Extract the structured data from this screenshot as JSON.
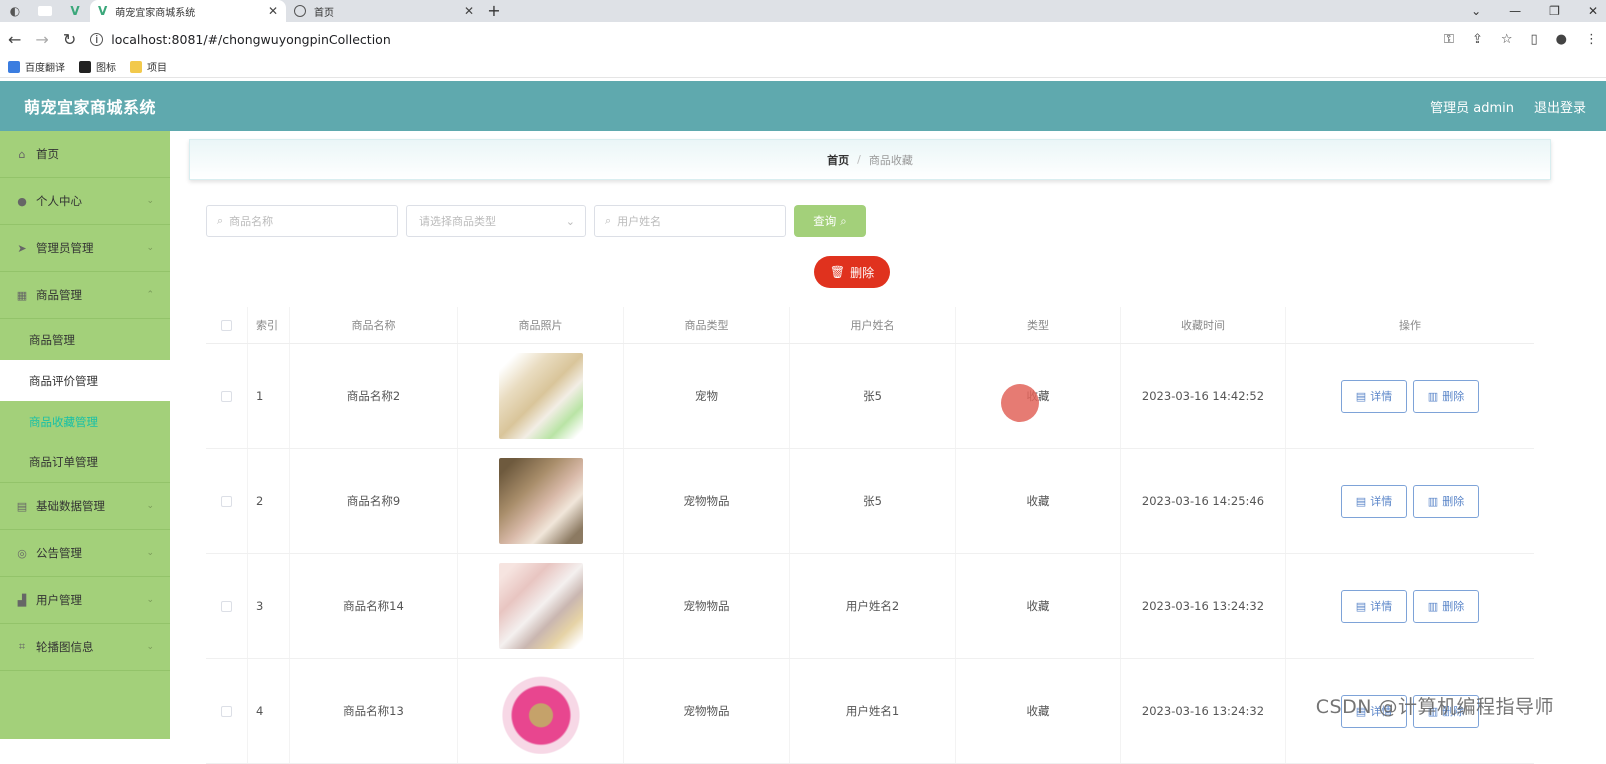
{
  "browser": {
    "tabs": [
      {
        "title": "萌宠宜家商城系统",
        "active": true
      },
      {
        "title": "首页",
        "active": false
      }
    ],
    "url": "localhost:8081/#/chongwuyongpinCollection",
    "bookmarks": [
      "百度翻译",
      "图标",
      "项目"
    ]
  },
  "header": {
    "title": "萌宠宜家商城系统",
    "user": "管理员 admin",
    "logout": "退出登录"
  },
  "sidebar": {
    "items": [
      {
        "label": "首页",
        "icon": "home-icon"
      },
      {
        "label": "个人中心",
        "icon": "user-icon"
      },
      {
        "label": "管理员管理",
        "icon": "send-icon"
      },
      {
        "label": "商品管理",
        "icon": "grid-icon"
      },
      {
        "label": "基础数据管理",
        "icon": "data-icon"
      },
      {
        "label": "公告管理",
        "icon": "notice-icon"
      },
      {
        "label": "用户管理",
        "icon": "users-icon"
      },
      {
        "label": "轮播图信息",
        "icon": "crop-icon"
      }
    ],
    "submenu": [
      "商品管理",
      "商品评价管理",
      "商品收藏管理",
      "商品订单管理"
    ]
  },
  "breadcrumb": {
    "home": "首页",
    "separator": "/",
    "current": "商品收藏"
  },
  "search": {
    "name_placeholder": "商品名称",
    "type_placeholder": "请选择商品类型",
    "user_placeholder": "用户姓名",
    "button": "查询"
  },
  "delete_button": "删除",
  "table": {
    "headers": [
      "索引",
      "商品名称",
      "商品照片",
      "商品类型",
      "用户姓名",
      "类型",
      "收藏时间",
      "操作"
    ],
    "rows": [
      {
        "index": "1",
        "name": "商品名称2",
        "category": "宠物",
        "user": "张5",
        "type": "收藏",
        "time": "2023-03-16 14:42:52"
      },
      {
        "index": "2",
        "name": "商品名称9",
        "category": "宠物物品",
        "user": "张5",
        "type": "收藏",
        "time": "2023-03-16 14:25:46"
      },
      {
        "index": "3",
        "name": "商品名称14",
        "category": "宠物物品",
        "user": "用户姓名2",
        "type": "收藏",
        "time": "2023-03-16 13:24:32"
      },
      {
        "index": "4",
        "name": "商品名称13",
        "category": "宠物物品",
        "user": "用户姓名1",
        "type": "收藏",
        "time": "2023-03-16 13:24:32"
      }
    ],
    "detail_label": "详情",
    "delete_label": "删除"
  },
  "watermark": "CSDN @计算机编程指导师"
}
